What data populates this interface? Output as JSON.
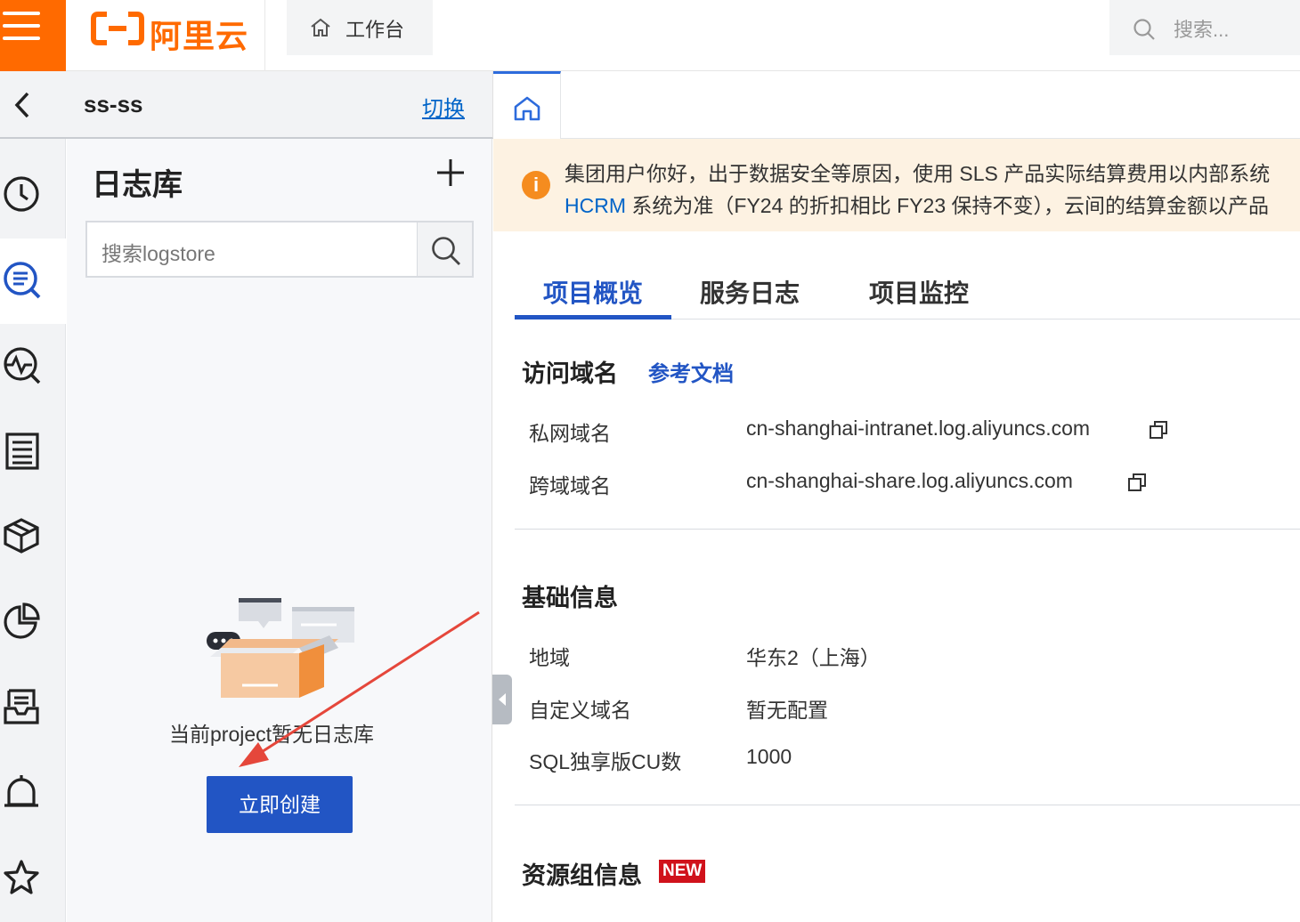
{
  "header": {
    "logo_text": "阿里云",
    "workbench_label": "工作台",
    "search_placeholder": "搜索..."
  },
  "project": {
    "name": "ss-ss",
    "switch_label": "切换"
  },
  "sidebar_icons": [
    "clock-icon",
    "log-search-icon",
    "monitor-search-icon",
    "report-icon",
    "cube-icon",
    "pie-chart-icon",
    "inbox-icon",
    "bell-icon",
    "star-icon"
  ],
  "logstore": {
    "title": "日志库",
    "search_placeholder": "搜索logstore",
    "empty_text": "当前project暂无日志库",
    "create_label": "立即创建"
  },
  "notice": {
    "line1": "集团用户你好，出于数据安全等原因，使用 SLS 产品实际结算费用以内部系统",
    "line2_link": "HCRM",
    "line2_rest": " 系统为准（FY24 的折扣相比 FY23 保持不变），云间的结算金额以产品"
  },
  "tabs": [
    "项目概览",
    "服务日志",
    "项目监控"
  ],
  "access": {
    "title": "访问域名",
    "doc_link": "参考文档",
    "rows": [
      {
        "label": "私网域名",
        "value": "cn-shanghai-intranet.log.aliyuncs.com"
      },
      {
        "label": "跨域域名",
        "value": "cn-shanghai-share.log.aliyuncs.com"
      }
    ]
  },
  "basic": {
    "title": "基础信息",
    "rows": [
      {
        "label": "地域",
        "value": "华东2（上海）"
      },
      {
        "label": "自定义域名",
        "value": "暂无配置"
      },
      {
        "label": "SQL独享版CU数",
        "value": "1000"
      }
    ]
  },
  "resource": {
    "title": "资源组信息",
    "badge": "NEW"
  },
  "colors": {
    "brand": "#ff6a00",
    "primary": "#2255c4",
    "link": "#0064c8",
    "notice_bg": "#fdf2e2",
    "annotation_arrow": "#e5473b"
  }
}
